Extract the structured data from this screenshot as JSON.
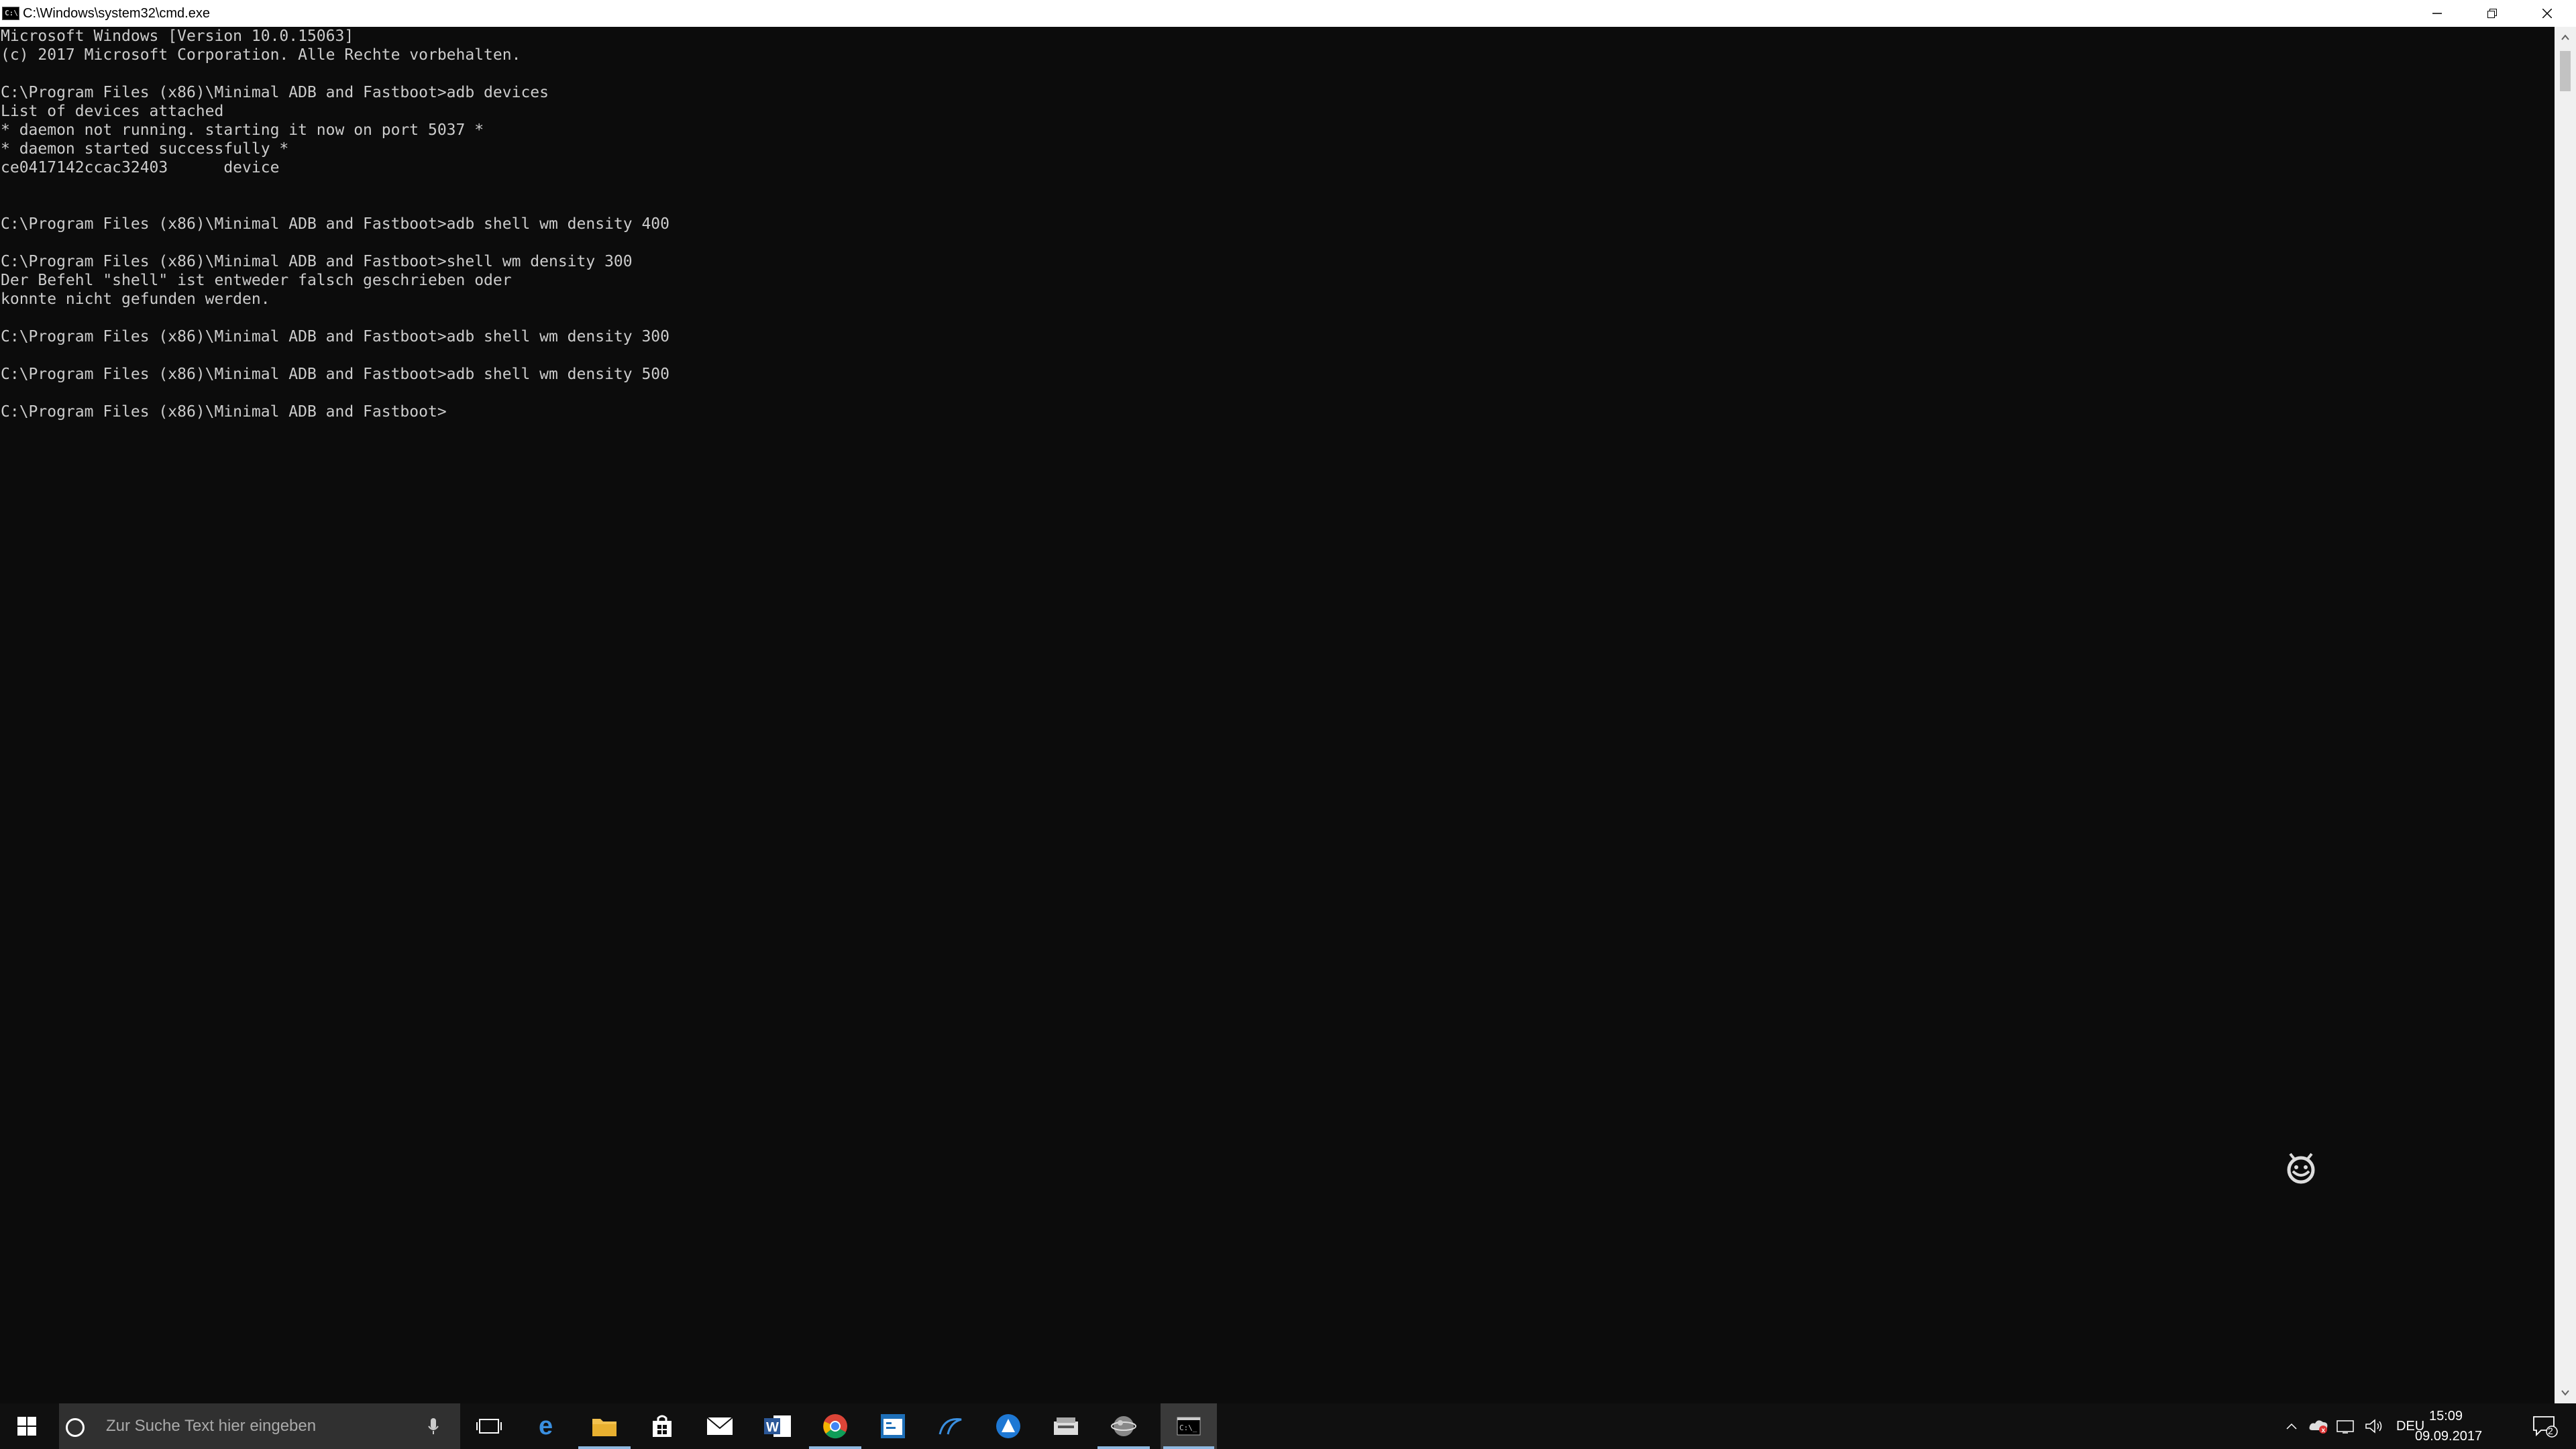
{
  "window": {
    "title": "C:\\Windows\\system32\\cmd.exe",
    "icon_text": "C:\\"
  },
  "console": {
    "lines": [
      "Microsoft Windows [Version 10.0.15063]",
      "(c) 2017 Microsoft Corporation. Alle Rechte vorbehalten.",
      "",
      "C:\\Program Files (x86)\\Minimal ADB and Fastboot>adb devices",
      "List of devices attached",
      "* daemon not running. starting it now on port 5037 *",
      "* daemon started successfully *",
      "ce0417142ccac32403      device",
      "",
      "",
      "C:\\Program Files (x86)\\Minimal ADB and Fastboot>adb shell wm density 400",
      "",
      "C:\\Program Files (x86)\\Minimal ADB and Fastboot>shell wm density 300",
      "Der Befehl \"shell\" ist entweder falsch geschrieben oder",
      "konnte nicht gefunden werden.",
      "",
      "C:\\Program Files (x86)\\Minimal ADB and Fastboot>adb shell wm density 300",
      "",
      "C:\\Program Files (x86)\\Minimal ADB and Fastboot>adb shell wm density 500",
      "",
      "C:\\Program Files (x86)\\Minimal ADB and Fastboot>"
    ]
  },
  "taskbar": {
    "search_placeholder": "Zur Suche Text hier eingeben",
    "apps": [
      "task-view",
      "edge",
      "file-explorer",
      "store",
      "mail",
      "word",
      "chrome",
      "app-remote",
      "app-swirl",
      "app-triangle",
      "app-dock",
      "app-orb",
      "cmd"
    ],
    "tray": {
      "language": "DEU",
      "time": "15:09",
      "date": "09.09.2017",
      "notification_count": "2"
    }
  },
  "colors": {
    "console_bg": "#0c0c0c",
    "console_fg": "#cccccc",
    "taskbar_bg": "#101010",
    "accent": "#8fb8e0"
  }
}
